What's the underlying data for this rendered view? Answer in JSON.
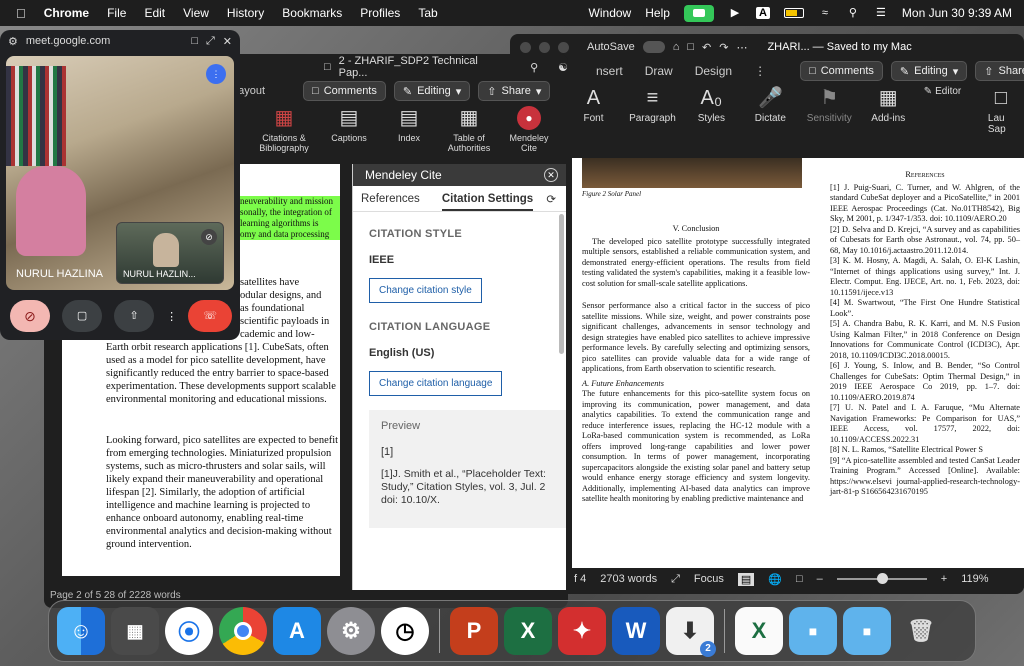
{
  "menubar": {
    "app": "Chrome",
    "items": [
      "File",
      "Edit",
      "View",
      "History",
      "Bookmarks",
      "Profiles",
      "Tab"
    ],
    "right_items": [
      "Window",
      "Help"
    ],
    "datetime": "Mon Jun 30  9:39 AM"
  },
  "meet": {
    "url": "meet.google.com",
    "main_name": "NURUL HAZLINA",
    "self_name": "NURUL HAZLIN..."
  },
  "word1": {
    "title": "2 - ZHARIF_SDP2 Technical Pap...",
    "tabs": [
      "Layout"
    ],
    "comments_label": "Comments",
    "editing_label": "Editing",
    "share_label": "Share",
    "ribbon": [
      {
        "label": "Citations & Bibliography"
      },
      {
        "label": "Captions"
      },
      {
        "label": "Index"
      },
      {
        "label": "Table of Authorities"
      },
      {
        "label": "Mendeley Cite"
      }
    ],
    "highlight_lines": [
      "neuverability and mission",
      "sonally, the integration of",
      " learning algorithms is",
      "omy and data processing"
    ],
    "body_lines_1": [
      "satellites have",
      "odular designs, and",
      "as foundational",
      "scientific payloads in",
      "cademic and low-"
    ],
    "para1": "Earth orbit research applications [1]. CubeSats, often used as a model for pico satellite development, have significantly reduced the entry barrier to space-based experimentation. These developments support scalable environmental monitoring and educational missions.",
    "para2": "Looking forward, pico satellites are expected to benefit from emerging technologies. Miniaturized propulsion systems, such as micro-thrusters and solar sails, will likely expand their maneuverability and operational lifespan [2]. Similarly, the adoption of artificial intelligence and machine learning is projected to enhance onboard autonomy, enabling real-time environmental analytics and decision-making without ground intervention.",
    "status": "Page 2 of 5    28 of 2228 words"
  },
  "mendeley": {
    "title": "Mendeley Cite",
    "tabs": [
      "References",
      "Citation Settings"
    ],
    "style_heading": "CITATION STYLE",
    "style_value": "IEEE",
    "change_style": "Change citation style",
    "lang_heading": "CITATION LANGUAGE",
    "lang_value": "English (US)",
    "change_lang": "Change citation language",
    "preview_label": "Preview",
    "preview_inline": "[1]",
    "preview_ref": "[1]J. Smith et al., “Placeholder Text: Study,” Citation Styles, vol. 3, Jul. 2 doi: 10.10/X."
  },
  "word2": {
    "autosave": "AutoSave",
    "title": "ZHARI... — Saved to my Mac",
    "tabs": [
      "nsert",
      "Draw",
      "Design"
    ],
    "comments_label": "Comments",
    "editing_label": "Editing",
    "share_label": "Share",
    "ribbon": [
      {
        "label": "Font"
      },
      {
        "label": "Paragraph"
      },
      {
        "label": "Styles"
      },
      {
        "label": "Dictate"
      },
      {
        "label": "Sensitivity"
      },
      {
        "label": "Add-ins"
      },
      {
        "label": "Editor"
      },
      {
        "label": "Lau Sap"
      }
    ],
    "fig_caption": "Figure 2 Solar Panel",
    "conclusion_heading": "V.   Conclusion",
    "conclusion": "The developed pico satellite prototype successfully integrated multiple sensors, established a reliable communication system, and demonstrated energy-efficient operations. The results from field testing validated the system's capabilities, making it a feasible low-cost solution for small-scale satellite applications.",
    "para_b": "Sensor performance also a critical factor in the success of pico satellite missions. While size, weight, and power constraints pose significant challenges, advancements in sensor technology and design strategies have enabled pico satellites to achieve impressive performance levels. By carefully selecting and optimizing sensors, pico satellites can provide valuable data for a wide range of applications, from Earth observation to scientific research.",
    "future_heading": "A. Future Enhancements",
    "future": "The future enhancements for this pico-satellite system focus on improving its communication, power management, and data analytics capabilities. To extend the communication range and reduce interference issues, replacing the HC-12 module with a LoRa-based communication system is recommended, as LoRa offers improved long-range capabilities and lower power consumption. In terms of power management, incorporating supercapacitors alongside the existing solar panel and battery setup would enhance energy storage efficiency and system longevity. Additionally, implementing AI-based data analytics can improve satellite health monitoring by enabling predictive maintenance and",
    "refs_heading": "References",
    "refs": [
      "[1] J. Puig-Suari, C. Turner, and W. Ahlgren, of the standard CubeSat deployer and a PicoSatellite,” in 2001 IEEE Aerospac Proceedings (Cat. No.01TH8542), Big Sky, M 2001, p. 1/347-1/353. doi: 10.1109/AERO.20",
      "[2] D. Selva and D. Krejci, “A survey and as capabilities of Cubesats for Earth obse Astronaut., vol. 74, pp. 50–68, May 10.1016/j.actaastro.2011.12.014.",
      "[3] K. M. Hosny, A. Magdi, A. Salah, O. El-K Lashin, “Internet of things applications using survey,” Int. J. Electr. Comput. Eng. IJECE, Art. no. 1, Feb. 2023, doi: 10.11591/ijece.v13",
      "[4] M. Swartwout, “The First One Hundre Statistical Look”.",
      "[5] A. Chandra Babu, R. K. Karri, and M. N.S Fusion Using Kalman Filter,” in 2018 Conference on Design Innovations for Communicate Control (ICDI3C), Apr. 2018, 10.1109/ICDI3C.2018.00015.",
      "[6] J. Young, S. Inlow, and B. Bender, “So Control Challenges for CubeSats: Optim Thermal Design,” in 2019 IEEE Aerospace Co 2019, pp. 1–7. doi: 10.1109/AERO.2019.874",
      "[7] U. N. Patel and I. A. Faruque, “Mu Alternate Navigation Frameworks: Pe Comparison for UAS,” IEEE Access, vol. 17577, 2022, doi: 10.1109/ACCESS.2022.31",
      "[8] N. L. Ramos, “Satellite Electrical Power S",
      "[9] “A pico-satellite assembled and tested CanSat Leader Training Program.” Accessed [Online]. Available: https://www.elsevi journal-applied-research-technology-jart-81-p S166564231670195"
    ],
    "status_words": "2703 words",
    "status_focus": "Focus",
    "status_zoom": "119%",
    "status_page": "f 4"
  },
  "dock": {
    "apps": [
      {
        "name": "Finder",
        "color": "#1e88e5"
      },
      {
        "name": "Launchpad",
        "color": "#555"
      },
      {
        "name": "Safari",
        "color": "#1976d2"
      },
      {
        "name": "Chrome",
        "color": "#fff"
      },
      {
        "name": "App Store",
        "color": "#1e88e5"
      },
      {
        "name": "System Settings",
        "color": "#777"
      },
      {
        "name": "Clock",
        "color": "#eee"
      },
      {
        "name": "PowerPoint",
        "color": "#c43e1c"
      },
      {
        "name": "Excel",
        "color": "#1d6f42"
      },
      {
        "name": "Acrobat",
        "color": "#d32f2f"
      },
      {
        "name": "Word",
        "color": "#185abd"
      },
      {
        "name": "Installer",
        "color": "#f5f5f5"
      },
      {
        "name": "Excel Doc",
        "color": "#f5f5f5"
      },
      {
        "name": "Folder",
        "color": "#4aa3df"
      },
      {
        "name": "Folder 2",
        "color": "#4aa3df"
      },
      {
        "name": "Trash",
        "color": "#bbb"
      }
    ],
    "installer_badge": "2"
  }
}
